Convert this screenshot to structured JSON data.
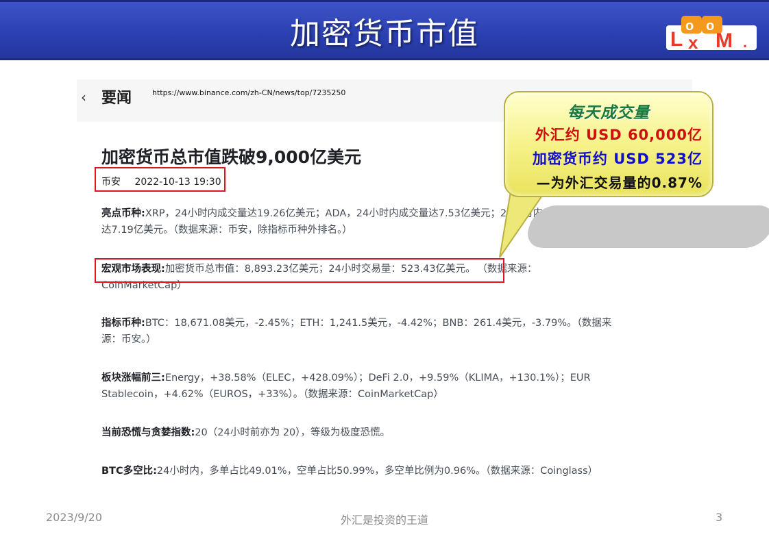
{
  "slide": {
    "title": "加密货币市值",
    "logo_text": "LOOKM"
  },
  "article": {
    "back_icon": "chevron-left-icon",
    "section": "要闻",
    "url": "https://www.binance.com/zh-CN/news/top/7235250",
    "headline": "加密货币总市值跌破9,000亿美元",
    "source": "币安",
    "datetime": "2022-10-13 19:30",
    "paragraphs": [
      {
        "label": "亮点币种:",
        "text": "XRP，24小时内成交量达19.26亿美元；ADA，24小时内成交量达7.53亿美元；",
        "text_hidden_tail": "24小时内成交量",
        "line2": "达7.19亿美元。（数据来源：币安，除指标币种外排名。）"
      },
      {
        "label": "宏观市场表现:",
        "text": "加密货币总市值：8,893.23亿美元；24小时交易量：523.43亿美元。",
        "tail": "（数据来源：",
        "line2": "CoinMarketCap）"
      },
      {
        "label": "指标币种:",
        "text": "BTC：18,671.08美元，-2.45%；ETH：1,241.5美元，-4.42%；BNB：261.4美元，-3.79%。（数据来",
        "line2": "源：币安。）"
      },
      {
        "label": "板块涨幅前三:",
        "text": "Energy，+38.58%（ELEC，+428.09%）；DeFi 2.0，+9.59%（KLIMA，+130.1%）；EUR",
        "line2": "Stablecoin，+4.62%（EUROS，+33%）。（数据来源：CoinMarketCap）"
      },
      {
        "label": "当前恐慌与贪婪指数:",
        "text": "20（24小时前亦为 20），等级为极度恐慌。"
      },
      {
        "label": "BTC多空比:",
        "text": "24小时内，多单占比49.01%，空单占比50.99%，多空单比例为0.96%。（数据来源：Coinglass）"
      }
    ]
  },
  "callout": {
    "title": "每天成交量",
    "fx": "外汇约 USD 60,000亿",
    "crypto": "加密货币约 USD 523亿",
    "ratio": "—为外汇交易量的0.87%"
  },
  "footer": {
    "date": "2023/9/20",
    "center": "外汇是投资的王道",
    "page": "3"
  }
}
